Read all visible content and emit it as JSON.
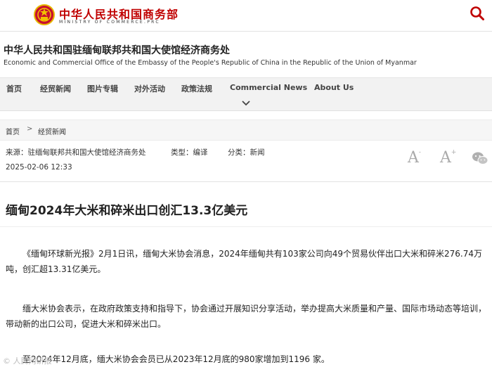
{
  "header": {
    "logo_cn": "中华人民共和国商务部",
    "logo_en": "MINISTRY OF COMMERCE.PRC"
  },
  "office": {
    "name_cn": "中华人民共和国驻缅甸联邦共和国大使馆经济商务处",
    "name_en": "Economic and Commercial Office of the Embassy of the People's Republic of China in the Republic of the Union of Myanmar"
  },
  "nav": {
    "items": [
      "首页",
      "经贸新闻",
      "图片专辑",
      "对外活动",
      "政策法规",
      "Commercial News",
      "About Us"
    ]
  },
  "breadcrumb": {
    "home": "首页",
    "sep": ">",
    "current": "经贸新闻"
  },
  "article": {
    "source": "来源：驻缅甸联邦共和国大使馆经济商务处",
    "type": "类型：编译",
    "category": "分类：新闻",
    "date": "2025-02-06 12:33",
    "title": "缅甸2024年大米和碎米出口创汇13.3亿美元",
    "paragraphs": [
      "《缅甸环球新光报》2月1日讯，缅甸大米协会消息，2024年缅甸共有103家公司向49个贸易伙伴出口大米和碎米276.74万吨，创汇超13.31亿美元。",
      "缅大米协会表示，在政府政策支持和指导下，协会通过开展知识分享活动，举办提高大米质量和产量、国际市场动态等培训，带动新的出口公司，促进大米和碎米出口。",
      "至2024年12月底，缅大米协会会员已从2023年12月底的980家增加到1196 家。"
    ]
  },
  "font_controls": {
    "decrease": "A",
    "increase": "A",
    "minus": "-",
    "plus": "+"
  },
  "watermark": "© 人民网研报"
}
